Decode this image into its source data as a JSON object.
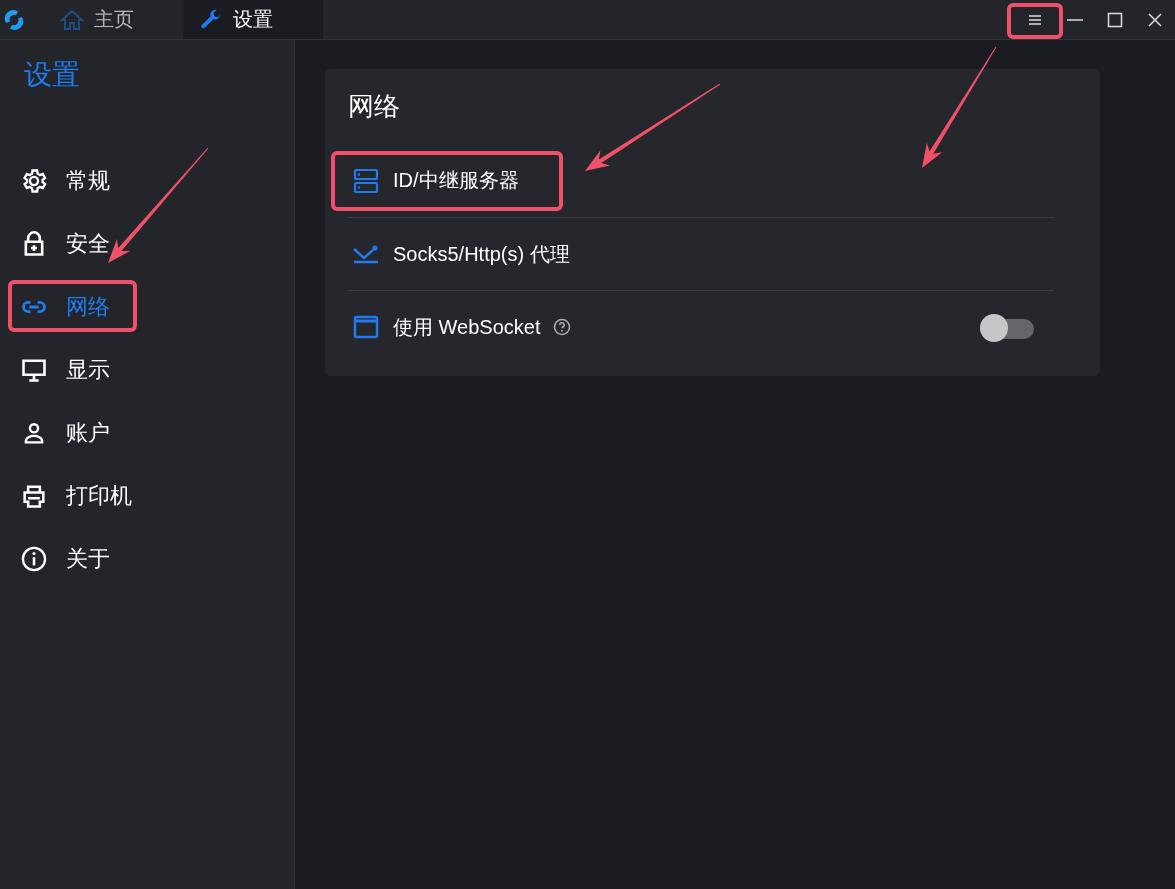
{
  "titlebar": {
    "tabs": [
      {
        "label": "主页",
        "selected": false
      },
      {
        "label": "设置",
        "selected": true
      }
    ]
  },
  "sidebar": {
    "title": "设置",
    "items": [
      {
        "label": "常规",
        "selected": false
      },
      {
        "label": "安全",
        "selected": false
      },
      {
        "label": "网络",
        "selected": true
      },
      {
        "label": "显示",
        "selected": false
      },
      {
        "label": "账户",
        "selected": false
      },
      {
        "label": "打印机",
        "selected": false
      },
      {
        "label": "关于",
        "selected": false
      }
    ]
  },
  "panel": {
    "title": "网络",
    "rows": [
      {
        "label": "ID/中继服务器",
        "kind": "link"
      },
      {
        "label": "Socks5/Http(s) 代理",
        "kind": "link"
      },
      {
        "label": "使用 WebSocket",
        "kind": "toggle",
        "help": true,
        "on": false
      }
    ]
  }
}
